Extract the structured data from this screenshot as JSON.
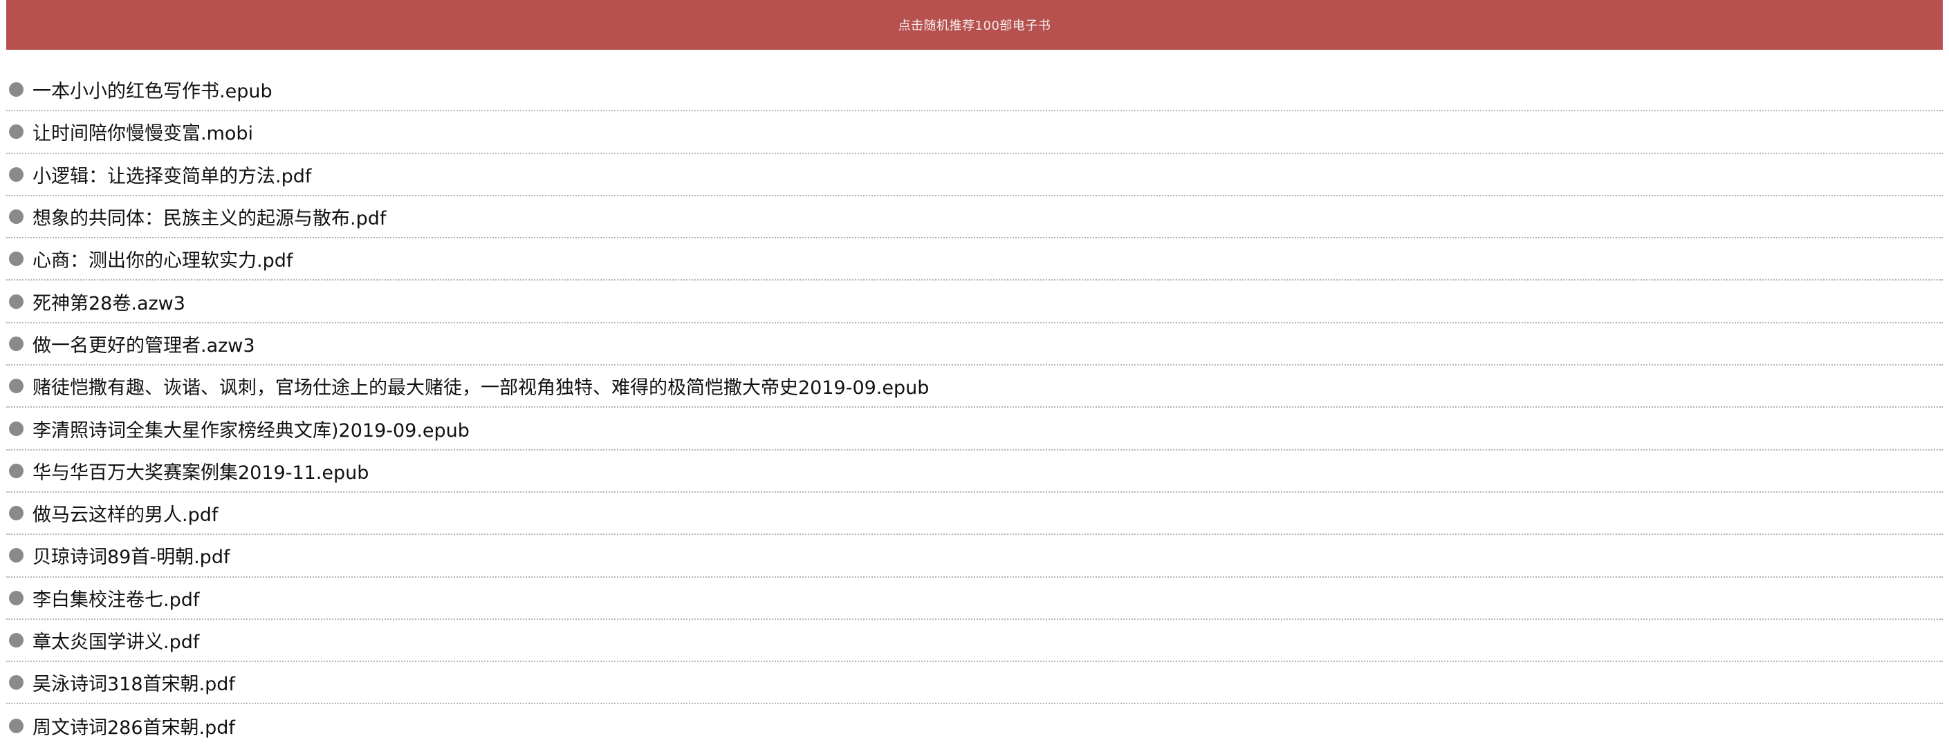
{
  "banner": {
    "label": "点击随机推荐100部电子书"
  },
  "books": [
    "一本小小的红色写作书.epub",
    "让时间陪你慢慢变富.mobi",
    "小逻辑：让选择变简单的方法.pdf",
    "想象的共同体：民族主义的起源与散布.pdf",
    "心商：测出你的心理软实力.pdf",
    "死神第28卷.azw3",
    "做一名更好的管理者.azw3",
    "赌徒恺撒有趣、诙谐、讽刺，官场仕途上的最大赌徒，一部视角独特、难得的极简恺撒大帝史2019-09.epub",
    "李清照诗词全集大星作家榜经典文库)2019-09.epub",
    "华与华百万大奖赛案例集2019-11.epub",
    "做马云这样的男人.pdf",
    "贝琼诗词89首-明朝.pdf",
    "李白集校注卷七.pdf",
    "章太炎国学讲义.pdf",
    "吴泳诗词318首宋朝.pdf",
    "周文诗词286首宋朝.pdf"
  ],
  "colors": {
    "banner_bg": "#b65150",
    "bullet": "#8a8a8a",
    "divider": "#b4b4b4"
  }
}
